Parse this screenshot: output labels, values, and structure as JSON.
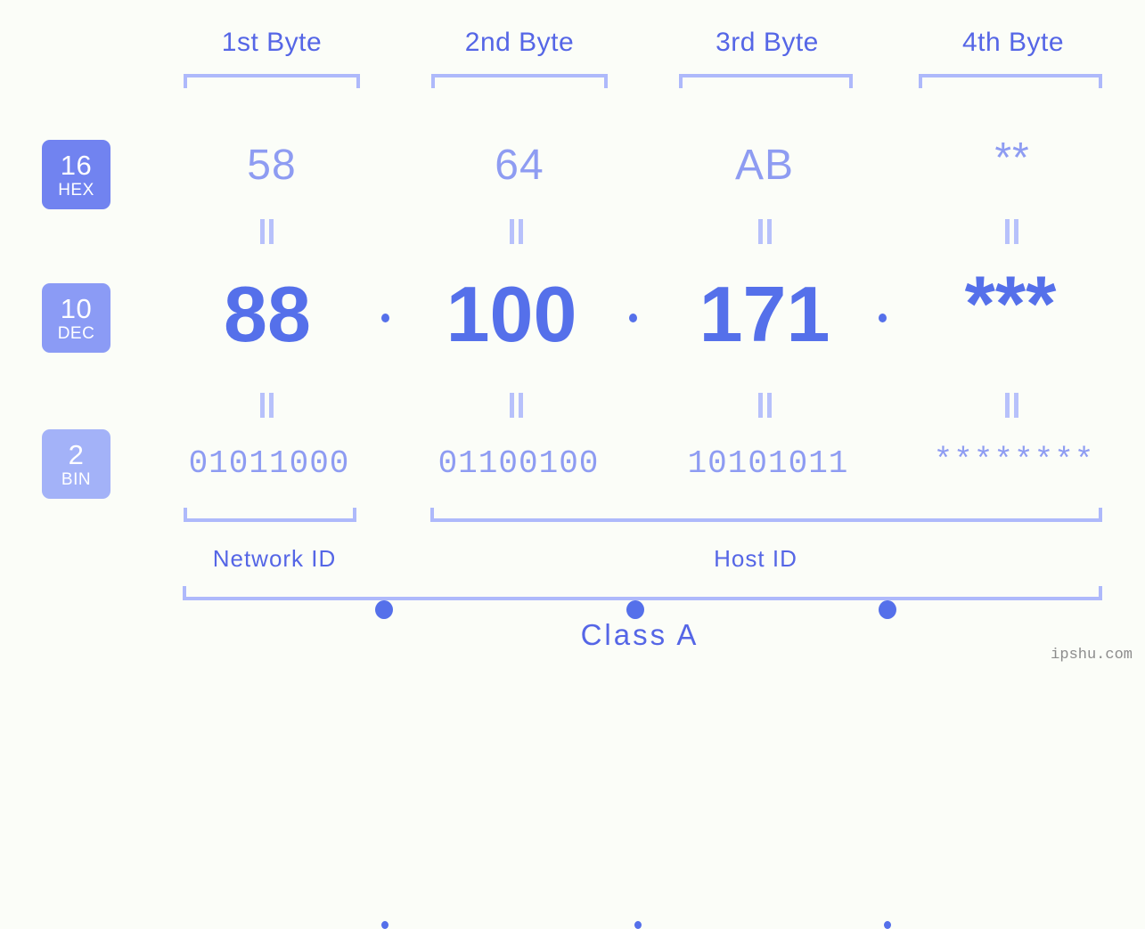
{
  "theme": {
    "background": "#fbfdf8",
    "primary_blue": "#5566e6",
    "value_blue": "#5570ea",
    "light_periwinkle": "#8e9cf2",
    "bracket": "#aeb9fb",
    "badge_hex": "#7183f0",
    "badge_dec": "#8b9bf5",
    "badge_bin": "#a3b2f8",
    "watermark_gray": "#8c8c8c"
  },
  "header": {
    "bytes": [
      {
        "label": "1st Byte"
      },
      {
        "label": "2nd Byte"
      },
      {
        "label": "3rd Byte"
      },
      {
        "label": "4th Byte"
      }
    ]
  },
  "bases": [
    {
      "num": "16",
      "name": "HEX"
    },
    {
      "num": "10",
      "name": "DEC"
    },
    {
      "num": "2",
      "name": "BIN"
    }
  ],
  "rows": {
    "hex": {
      "octets": [
        "58",
        "64",
        "AB",
        "**"
      ],
      "separator": "."
    },
    "dec": {
      "octets": [
        "88",
        "100",
        "171",
        "***"
      ],
      "separator": "."
    },
    "bin": {
      "octets": [
        "01011000",
        "01100100",
        "10101011",
        "********"
      ],
      "separator": "."
    }
  },
  "equals_marks": {
    "hex_to_dec": [
      "=",
      "=",
      "=",
      "="
    ],
    "dec_to_bin": [
      "=",
      "=",
      "=",
      "="
    ]
  },
  "footer": {
    "network_id_label": "Network ID",
    "host_id_label": "Host ID",
    "class_label": "Class A"
  },
  "watermark": {
    "text": "ipshu.com"
  }
}
